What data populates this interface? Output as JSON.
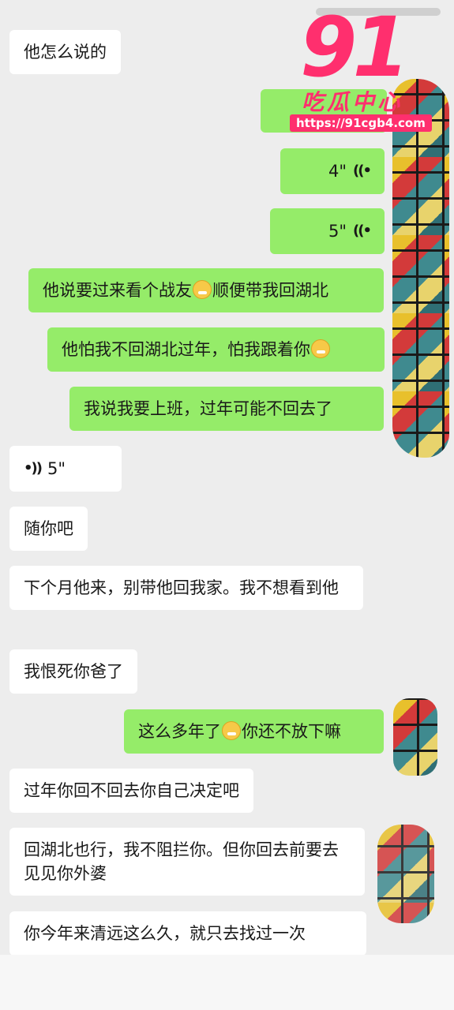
{
  "watermark": {
    "logo": "91",
    "name": "吃瓜中心",
    "url": "https://91cgb4.com"
  },
  "messages": [
    {
      "side": "in",
      "type": "text",
      "text": "他怎么说的"
    },
    {
      "side": "out",
      "type": "voice",
      "duration": "4\""
    },
    {
      "side": "out",
      "type": "voice",
      "duration": "5\""
    },
    {
      "side": "out",
      "type": "text",
      "parts": [
        "他说要过来看个战友",
        "顺便带我回湖北"
      ]
    },
    {
      "side": "out",
      "type": "text",
      "parts": [
        "他怕我不回湖北过年，怕我跟着你",
        ""
      ]
    },
    {
      "side": "out",
      "type": "text",
      "text": "我说我要上班，过年可能不回去了"
    },
    {
      "side": "in",
      "type": "voice",
      "duration": "5\""
    },
    {
      "side": "in",
      "type": "text",
      "text": "随你吧"
    },
    {
      "side": "in",
      "type": "text",
      "text": "下个月他来，别带他回我家。我不想看到他"
    },
    {
      "side": "in",
      "type": "text",
      "text": "我恨死你爸了"
    },
    {
      "side": "out",
      "type": "text",
      "parts": [
        "这么多年了",
        "你还不放下嘛"
      ]
    },
    {
      "side": "in",
      "type": "text",
      "text": "过年你回不回去你自己决定吧"
    },
    {
      "side": "in",
      "type": "text",
      "text": "回湖北也行，我不阻拦你。但你回去前要去见见你外婆"
    },
    {
      "side": "in",
      "type": "text",
      "text": "你今年来清远这么久，就只去找过一次"
    }
  ]
}
